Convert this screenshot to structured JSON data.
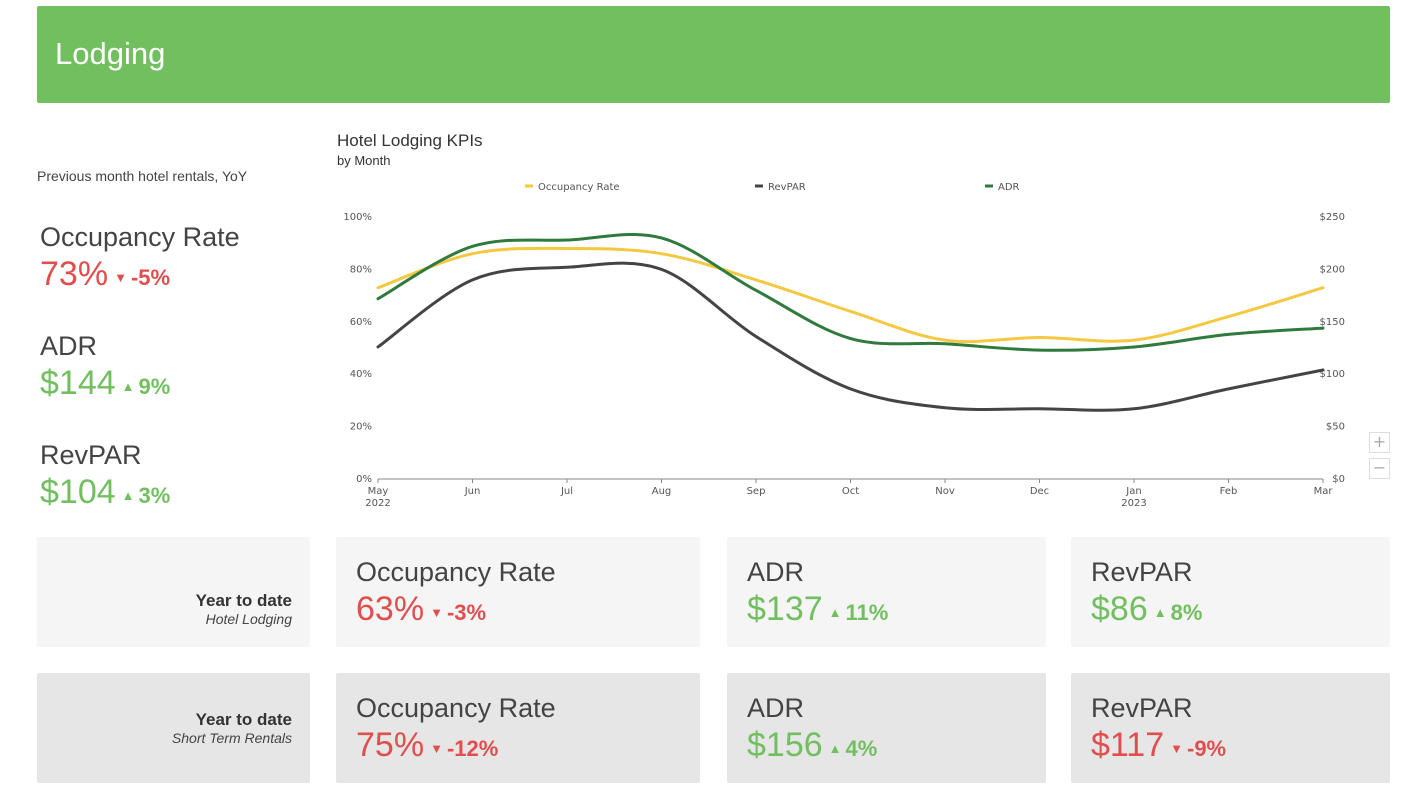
{
  "header": {
    "title": "Lodging"
  },
  "summary": {
    "subtitle": "Previous month hotel rentals, YoY",
    "kpis": [
      {
        "name": "Occupancy Rate",
        "value": "73%",
        "arrow": "▼",
        "delta": "-5%",
        "trend": "down"
      },
      {
        "name": "ADR",
        "value": "$144",
        "arrow": "▲",
        "delta": "9%",
        "trend": "up"
      },
      {
        "name": "RevPAR",
        "value": "$104",
        "arrow": "▲",
        "delta": "3%",
        "trend": "up"
      }
    ]
  },
  "chart_data": {
    "type": "line",
    "title": "Hotel Lodging KPIs",
    "subtitle": "by Month",
    "legend_position": "top",
    "grid": false,
    "x": [
      "May 2022",
      "Jun",
      "Jul",
      "Aug",
      "Sep",
      "Oct",
      "Nov",
      "Dec",
      "Jan 2023",
      "Feb",
      "Mar"
    ],
    "x_tick_labels": [
      {
        "line1": "May",
        "line2": "2022"
      },
      {
        "line1": "Jun",
        "line2": ""
      },
      {
        "line1": "Jul",
        "line2": ""
      },
      {
        "line1": "Aug",
        "line2": ""
      },
      {
        "line1": "Sep",
        "line2": ""
      },
      {
        "line1": "Oct",
        "line2": ""
      },
      {
        "line1": "Nov",
        "line2": ""
      },
      {
        "line1": "Dec",
        "line2": ""
      },
      {
        "line1": "Jan",
        "line2": "2023"
      },
      {
        "line1": "Feb",
        "line2": ""
      },
      {
        "line1": "Mar",
        "line2": ""
      }
    ],
    "y_left": {
      "ticks": [
        "0%",
        "20%",
        "40%",
        "60%",
        "80%",
        "100%"
      ],
      "range": [
        0,
        100
      ]
    },
    "y_right": {
      "ticks": [
        "$0",
        "$50",
        "$100",
        "$150",
        "$200",
        "$250"
      ],
      "range": [
        0,
        250
      ]
    },
    "series": [
      {
        "name": "Occupancy Rate",
        "axis": "left",
        "color": "#f5c842",
        "values": [
          73,
          86,
          88,
          86,
          76,
          64,
          53,
          54,
          53,
          62,
          73
        ]
      },
      {
        "name": "RevPAR",
        "axis": "right",
        "color": "#444444",
        "values": [
          126,
          190,
          202,
          200,
          136,
          86,
          68,
          67,
          67,
          86,
          104
        ]
      },
      {
        "name": "ADR",
        "axis": "right",
        "color": "#2f7a3c",
        "values": [
          172,
          222,
          228,
          230,
          180,
          134,
          129,
          123,
          126,
          138,
          144
        ]
      }
    ]
  },
  "ytd": [
    {
      "label_main": "Year to date",
      "label_sub": "Hotel Lodging",
      "kpis": [
        {
          "name": "Occupancy Rate",
          "value": "63%",
          "arrow": "▼",
          "delta": "-3%",
          "trend": "down"
        },
        {
          "name": "ADR",
          "value": "$137",
          "arrow": "▲",
          "delta": "11%",
          "trend": "up"
        },
        {
          "name": "RevPAR",
          "value": "$86",
          "arrow": "▲",
          "delta": "8%",
          "trend": "up"
        }
      ]
    },
    {
      "label_main": "Year to date",
      "label_sub": "Short Term Rentals",
      "kpis": [
        {
          "name": "Occupancy Rate",
          "value": "75%",
          "arrow": "▼",
          "delta": "-12%",
          "trend": "down"
        },
        {
          "name": "ADR",
          "value": "$156",
          "arrow": "▲",
          "delta": "4%",
          "trend": "up"
        },
        {
          "name": "RevPAR",
          "value": "$117",
          "arrow": "▼",
          "delta": "-9%",
          "trend": "down"
        }
      ]
    }
  ],
  "zoom": {
    "in_icon": "plus-icon",
    "out_icon": "minus-icon",
    "in_label": "+",
    "out_label": "−"
  },
  "colors": {
    "banner": "#72bf60",
    "positive": "#72bf60",
    "negative": "#e04e4e",
    "card_light": "#f5f5f5",
    "card_dark": "#e6e6e6"
  }
}
